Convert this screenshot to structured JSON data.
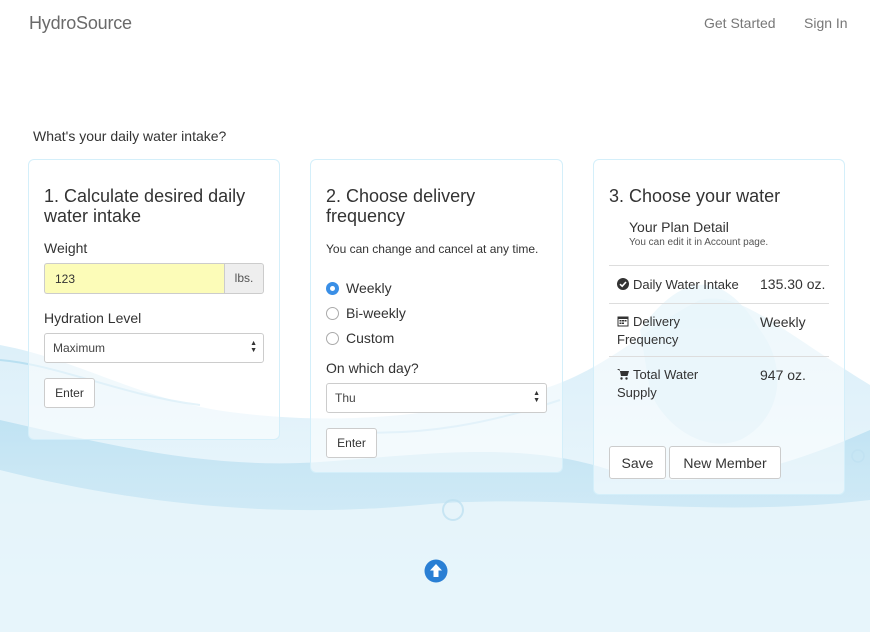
{
  "navbar": {
    "brand": "HydroSource",
    "links": [
      "Get Started",
      "Sign In"
    ]
  },
  "question": "What's your daily water intake?",
  "step1": {
    "title": "1. Calculate desired daily water intake",
    "weight_label": "Weight",
    "weight_value": "123",
    "weight_unit": "lbs.",
    "hydration_label": "Hydration Level",
    "hydration_selected": "Maximum",
    "enter_label": "Enter"
  },
  "step2": {
    "title": "2. Choose delivery frequency",
    "subtitle": "You can change and cancel at any time.",
    "options": [
      {
        "label": "Weekly",
        "checked": true
      },
      {
        "label": "Bi-weekly",
        "checked": false
      },
      {
        "label": "Custom",
        "checked": false
      }
    ],
    "day_label": "On which day?",
    "day_selected": "Thu",
    "enter_label": "Enter"
  },
  "step3": {
    "title": "3. Choose your water",
    "plan_title": "Your Plan Detail",
    "plan_sub": "You can edit it in Account page.",
    "rows": [
      {
        "key": "Daily Water Intake",
        "value": "135.30 oz.",
        "icon": "check-circle-icon"
      },
      {
        "key": "Delivery Frequency",
        "value": "Weekly",
        "icon": "calendar-icon"
      },
      {
        "key": "Total Water Supply",
        "value": "947 oz.",
        "icon": "cart-icon"
      }
    ],
    "save_label": "Save",
    "new_member_label": "New Member"
  },
  "colors": {
    "accent": "#3a8fe6",
    "input_highlight": "#fcfcb8",
    "card_border": "#d4effa"
  }
}
